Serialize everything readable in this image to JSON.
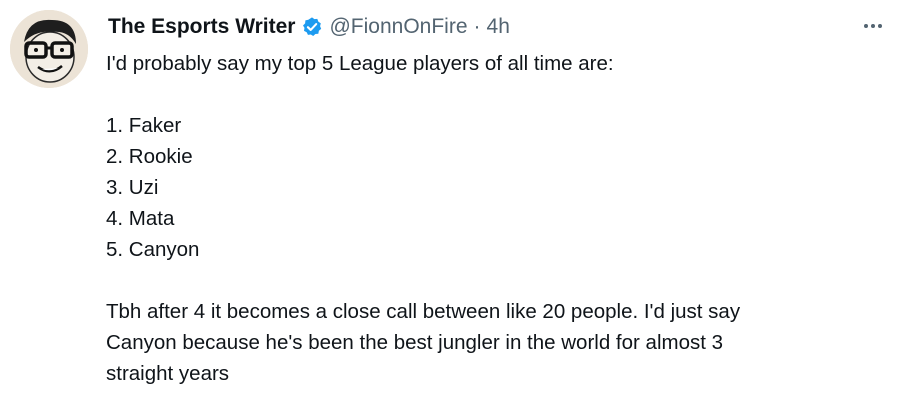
{
  "author": {
    "display_name": "The Esports Writer",
    "handle": "@FionnOnFire",
    "separator": "·",
    "time": "4h",
    "verified": true,
    "verified_color": "#1d9bf0"
  },
  "tweet": {
    "intro": "I'd probably say my top 5 League players of all time are:",
    "list": [
      "1. Faker",
      "2. Rookie",
      "3. Uzi",
      "4. Mata",
      "5. Canyon"
    ],
    "closing_lines": [
      "Tbh after 4 it becomes a close call between like 20 people. I'd just say",
      "Canyon because he's been the best jungler in the world for almost 3",
      "straight years"
    ]
  },
  "icons": {
    "avatar": "cartoon-face-with-glasses",
    "verified": "verified-badge-icon",
    "more": "more-options-icon"
  }
}
